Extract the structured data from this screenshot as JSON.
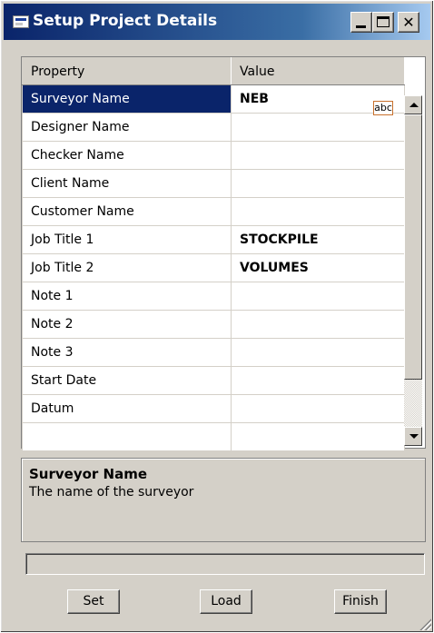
{
  "window": {
    "title": "Setup Project Details"
  },
  "grid": {
    "headers": {
      "property": "Property",
      "value": "Value"
    },
    "rows": [
      {
        "property": "Surveyor Name",
        "value": "NEB"
      },
      {
        "property": "Designer Name",
        "value": ""
      },
      {
        "property": "Checker Name",
        "value": ""
      },
      {
        "property": "Client Name",
        "value": ""
      },
      {
        "property": "Customer Name",
        "value": ""
      },
      {
        "property": "Job Title 1",
        "value": "STOCKPILE"
      },
      {
        "property": "Job Title 2",
        "value": "VOLUMES"
      },
      {
        "property": "Note 1",
        "value": ""
      },
      {
        "property": "Note 2",
        "value": ""
      },
      {
        "property": "Note 3",
        "value": ""
      },
      {
        "property": "Start Date",
        "value": ""
      },
      {
        "property": "Datum",
        "value": ""
      },
      {
        "property": "",
        "value": ""
      }
    ],
    "selected_row": 0,
    "editor_badge": "abc"
  },
  "description": {
    "title": "Surveyor Name",
    "text": "The name of the surveyor"
  },
  "status": {
    "text": ""
  },
  "buttons": {
    "set": "Set",
    "load": "Load",
    "finish": "Finish"
  },
  "colors": {
    "selection": "#0a246a",
    "dialog_face": "#d4d0c8",
    "title_gradient_start": "#0a246a",
    "title_gradient_end": "#a6caf0"
  },
  "icons": [
    "app-icon",
    "minimize-icon",
    "maximize-icon",
    "close-icon",
    "scroll-up-arrow-icon",
    "scroll-down-arrow-icon",
    "resize-grip-icon"
  ]
}
